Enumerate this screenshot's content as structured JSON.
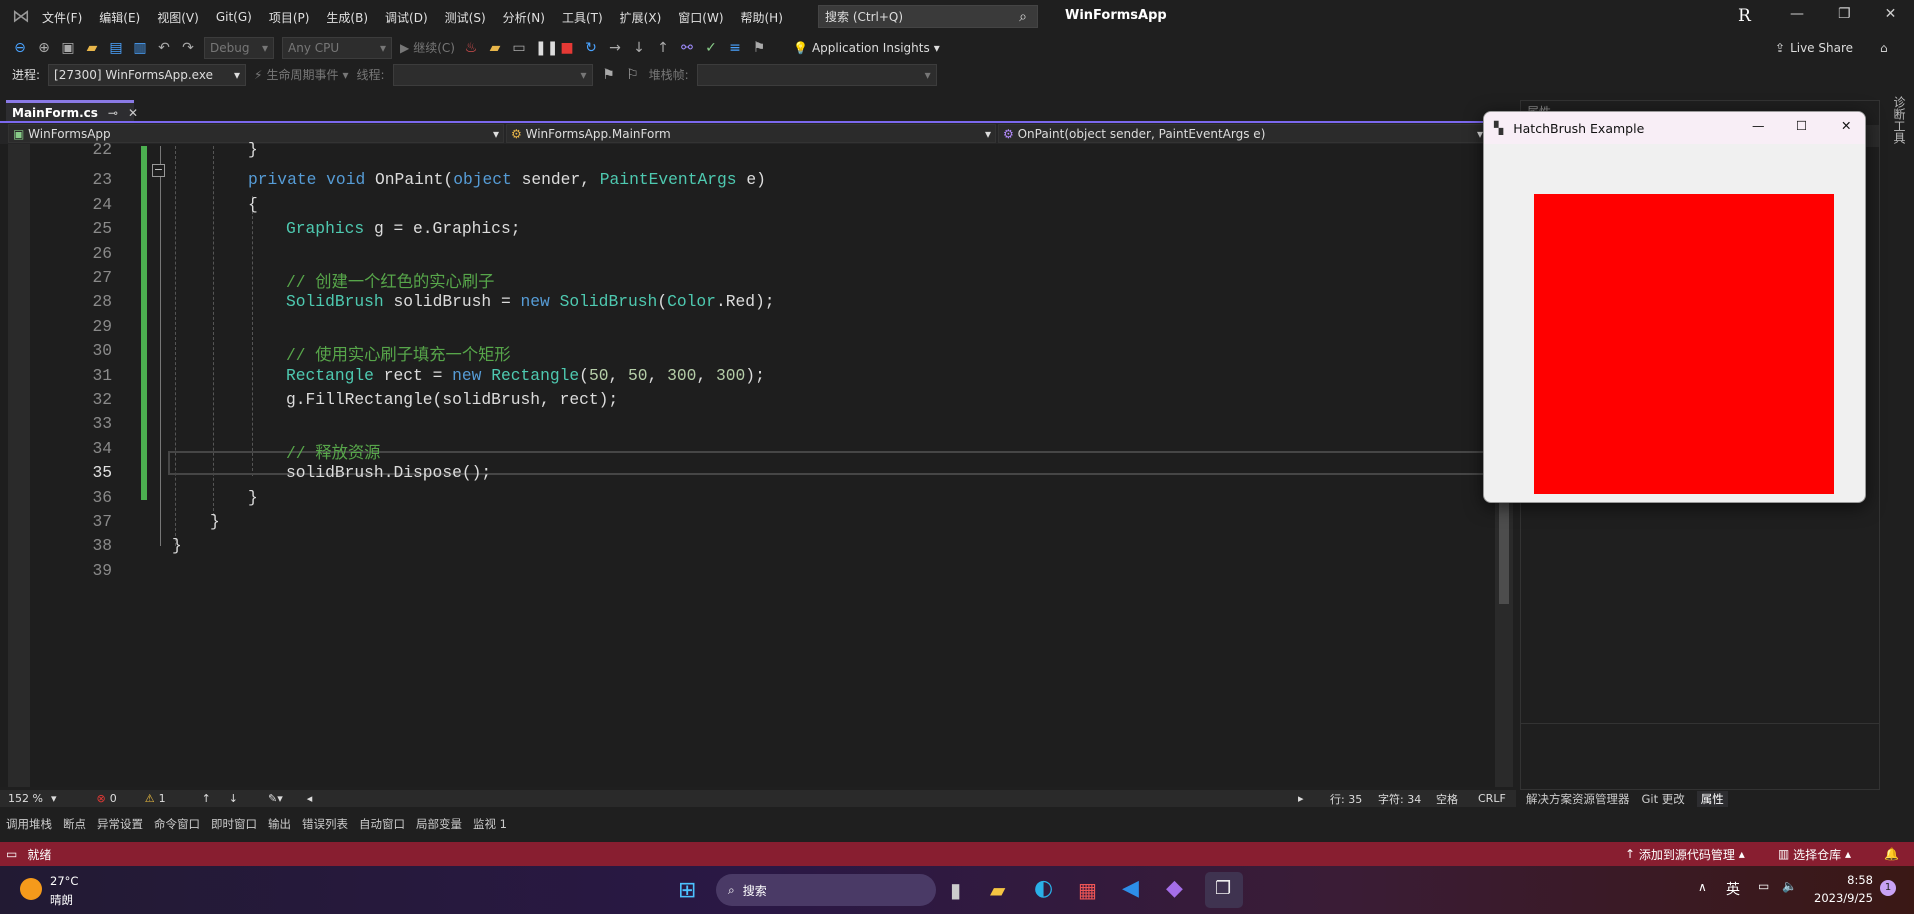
{
  "menu": {
    "items": [
      "文件(F)",
      "编辑(E)",
      "视图(V)",
      "Git(G)",
      "项目(P)",
      "生成(B)",
      "调试(D)",
      "测试(S)",
      "分析(N)",
      "工具(T)",
      "扩展(X)",
      "窗口(W)",
      "帮助(H)"
    ],
    "search": "搜索 (Ctrl+Q)",
    "app_title": "WinFormsApp",
    "user_initial": "R"
  },
  "toolbar": {
    "config": "Debug",
    "platform": "Any CPU",
    "continue": "继续(C)",
    "app_insights": "Application Insights",
    "live_share": "Live Share"
  },
  "toolbar2": {
    "process_label": "进程:",
    "process": "[27300] WinFormsApp.exe",
    "lifecycle": "生命周期事件",
    "thread_label": "线程:",
    "stack_label": "堆栈帧:"
  },
  "tab": {
    "label": "MainForm.cs"
  },
  "nav": {
    "project": "WinFormsApp",
    "class": "WinFormsApp.MainForm",
    "member": "OnPaint(object sender, PaintEventArgs e)"
  },
  "editor": {
    "current_line": 35,
    "lines": [
      {
        "n": 22,
        "indent": 2,
        "tokens": [
          [
            "}",
            "tx"
          ]
        ]
      },
      {
        "n": 23,
        "indent": 2,
        "tokens": [
          [
            "private void ",
            "kw"
          ],
          [
            "OnPaint(",
            "tx"
          ],
          [
            "object ",
            "kw"
          ],
          [
            "sender, ",
            "tx"
          ],
          [
            "PaintEventArgs ",
            "ty"
          ],
          [
            "e)",
            "tx"
          ]
        ]
      },
      {
        "n": 24,
        "indent": 2,
        "tokens": [
          [
            "{",
            "tx"
          ]
        ]
      },
      {
        "n": 25,
        "indent": 3,
        "tokens": [
          [
            "Graphics ",
            "ty"
          ],
          [
            "g = e.Graphics;",
            "tx"
          ]
        ]
      },
      {
        "n": 26,
        "indent": 3,
        "tokens": []
      },
      {
        "n": 27,
        "indent": 3,
        "tokens": [
          [
            "// 创建一个红色的实心刷子",
            "cm"
          ]
        ]
      },
      {
        "n": 28,
        "indent": 3,
        "tokens": [
          [
            "SolidBrush ",
            "ty"
          ],
          [
            "solidBrush = ",
            "tx"
          ],
          [
            "new ",
            "kw"
          ],
          [
            "SolidBrush",
            "ty"
          ],
          [
            "(",
            "tx"
          ],
          [
            "Color",
            "ty"
          ],
          [
            ".Red);",
            "tx"
          ]
        ]
      },
      {
        "n": 29,
        "indent": 3,
        "tokens": []
      },
      {
        "n": 30,
        "indent": 3,
        "tokens": [
          [
            "// 使用实心刷子填充一个矩形",
            "cm"
          ]
        ]
      },
      {
        "n": 31,
        "indent": 3,
        "tokens": [
          [
            "Rectangle ",
            "ty"
          ],
          [
            "rect = ",
            "tx"
          ],
          [
            "new ",
            "kw"
          ],
          [
            "Rectangle",
            "ty"
          ],
          [
            "(",
            "tx"
          ],
          [
            "50",
            "nm"
          ],
          [
            ", ",
            "tx"
          ],
          [
            "50",
            "nm"
          ],
          [
            ", ",
            "tx"
          ],
          [
            "300",
            "nm"
          ],
          [
            ", ",
            "tx"
          ],
          [
            "300",
            "nm"
          ],
          [
            ");",
            "tx"
          ]
        ]
      },
      {
        "n": 32,
        "indent": 3,
        "tokens": [
          [
            "g.FillRectangle(solidBrush, rect);",
            "tx"
          ]
        ]
      },
      {
        "n": 33,
        "indent": 3,
        "tokens": []
      },
      {
        "n": 34,
        "indent": 3,
        "tokens": [
          [
            "// 释放资源",
            "cm"
          ]
        ]
      },
      {
        "n": 35,
        "indent": 3,
        "tokens": [
          [
            "solidBrush.Dispose();",
            "tx"
          ]
        ]
      },
      {
        "n": 36,
        "indent": 2,
        "tokens": [
          [
            "}",
            "tx"
          ]
        ]
      },
      {
        "n": 37,
        "indent": 1,
        "tokens": [
          [
            "}",
            "tx"
          ]
        ]
      },
      {
        "n": 38,
        "indent": 0,
        "tokens": [
          [
            "}",
            "tx"
          ]
        ]
      },
      {
        "n": 39,
        "indent": 0,
        "tokens": []
      }
    ]
  },
  "status": {
    "zoom": "152 %",
    "errors": "0",
    "warnings": "1",
    "line": "行: 35",
    "col": "字符: 34",
    "spaces": "空格",
    "eol": "CRLF"
  },
  "bottom_tabs": [
    "调用堆栈",
    "断点",
    "异常设置",
    "命令窗口",
    "即时窗口",
    "输出",
    "错误列表",
    "自动窗口",
    "局部变量",
    "监视 1"
  ],
  "right_panel": {
    "title": "属性",
    "tabs": [
      "解决方案资源管理器",
      "Git 更改",
      "属性"
    ],
    "side": "诊断工具"
  },
  "statusbar": {
    "ready": "就绪",
    "source_control": "添加到源代码管理",
    "repo": "选择仓库"
  },
  "taskbar": {
    "temp": "27°C",
    "weather": "晴朗",
    "search": "搜索",
    "ime": "英",
    "time": "8:58",
    "date": "2023/9/25",
    "notif": "1"
  },
  "form": {
    "title": "HatchBrush Example",
    "fill_color": "#ff0000"
  },
  "colors": {
    "accent": "#7b68ee",
    "status_bar": "#881e30"
  }
}
